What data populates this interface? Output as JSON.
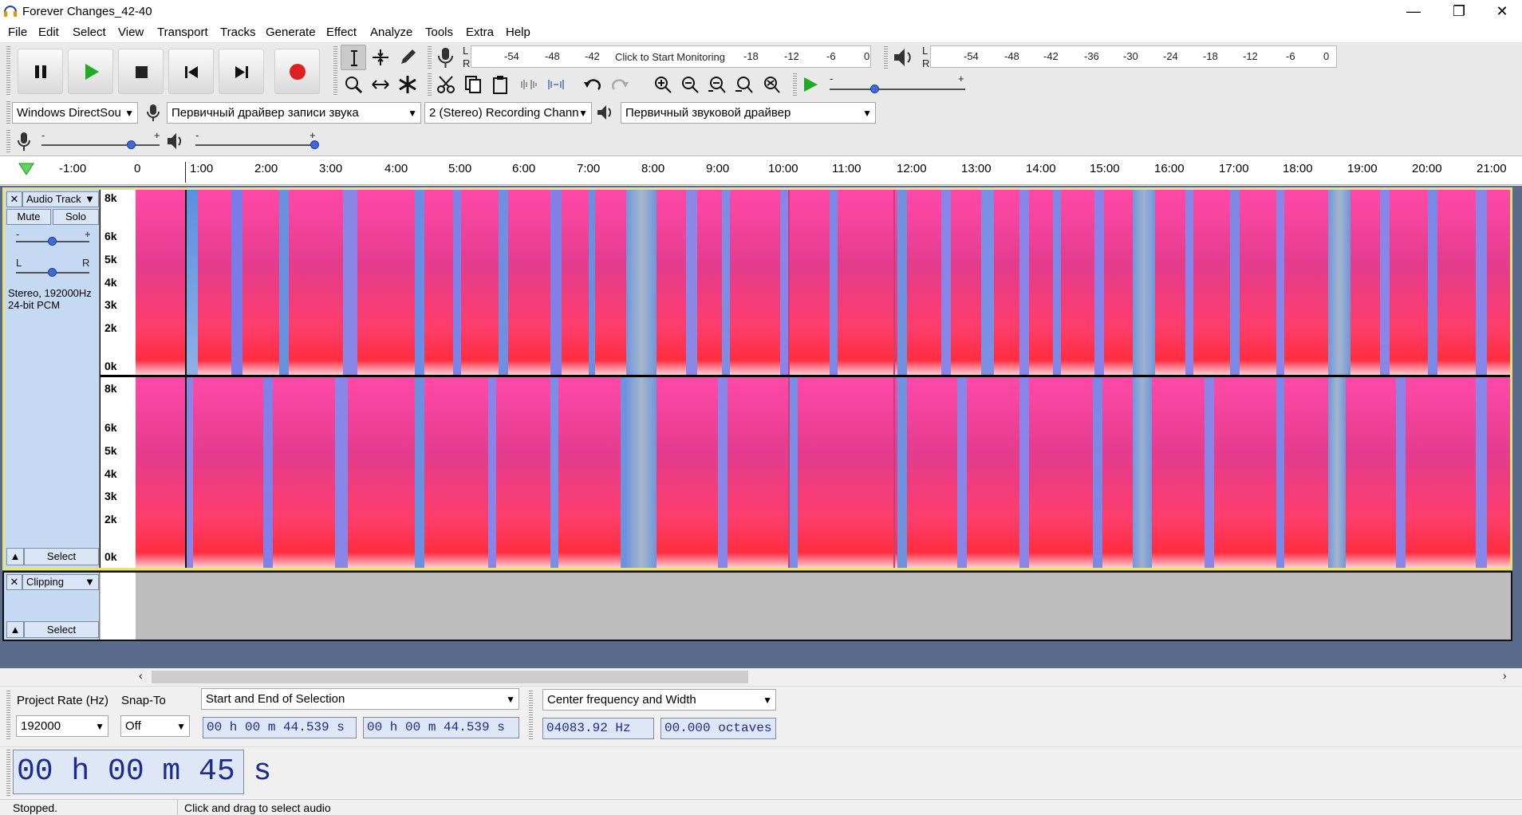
{
  "window": {
    "title": "Forever Changes_42-40",
    "min_glyph": "—",
    "max_glyph": "❐",
    "close_glyph": "✕"
  },
  "menu": [
    "File",
    "Edit",
    "Select",
    "View",
    "Transport",
    "Tracks",
    "Generate",
    "Effect",
    "Analyze",
    "Tools",
    "Extra",
    "Help"
  ],
  "transport": {
    "pause": "pause-icon",
    "play": "play-icon",
    "stop": "stop-icon",
    "skip_start": "skip-start-icon",
    "skip_end": "skip-end-icon",
    "record": "record-icon",
    "record_color": "#e02020",
    "play_color": "#22aa22"
  },
  "recording_meter": {
    "channels": [
      "L",
      "R"
    ],
    "ticks": [
      "-54",
      "-48",
      "-42",
      "-18",
      "-12",
      "-6",
      "0"
    ],
    "prompt": "Click to Start Monitoring"
  },
  "playback_meter": {
    "channels": [
      "L",
      "R"
    ],
    "ticks": [
      "-54",
      "-48",
      "-42",
      "-36",
      "-30",
      "-24",
      "-18",
      "-12",
      "-6",
      "0"
    ]
  },
  "playback_speed": {
    "minus": "-",
    "plus": "+"
  },
  "device": {
    "host": "Windows DirectSou",
    "recording_device": "Первичный драйвер записи звука",
    "channels": "2 (Stereo) Recording Chann",
    "playback_device": "Первичный звуковой драйвер"
  },
  "mixer": {
    "minus": "-",
    "plus": "+"
  },
  "ruler": {
    "labels": [
      "-1:00",
      "0",
      "1:00",
      "2:00",
      "3:00",
      "4:00",
      "5:00",
      "6:00",
      "7:00",
      "8:00",
      "9:00",
      "10:00",
      "11:00",
      "12:00",
      "13:00",
      "14:00",
      "15:00",
      "16:00",
      "17:00",
      "18:00",
      "19:00",
      "20:00",
      "21:00"
    ]
  },
  "audio_track": {
    "name": "Audio Track",
    "mute": "Mute",
    "solo": "Solo",
    "gain_minus": "-",
    "gain_plus": "+",
    "pan_left": "L",
    "pan_right": "R",
    "info_line1": "Stereo, 192000Hz",
    "info_line2": "24-bit PCM",
    "select": "Select",
    "freq_labels": [
      "8k",
      "6k",
      "5k",
      "4k",
      "3k",
      "2k",
      "0k"
    ]
  },
  "label_track": {
    "name": "Clipping",
    "select": "Select"
  },
  "selection_toolbar": {
    "project_rate_label": "Project Rate (Hz)",
    "project_rate": "192000",
    "snap_label": "Snap-To",
    "snap_value": "Off",
    "selection_mode": "Start and End of Selection",
    "start": "00 h 00 m 44.539 s",
    "end": "00 h 00 m 44.539 s"
  },
  "spectral_toolbar": {
    "mode": "Center frequency and Width",
    "frequency": "04083.92 Hz",
    "width": "00.000 octaves"
  },
  "time_toolbar": {
    "time": "00 h 00 m 45 s"
  },
  "status": {
    "state": "Stopped.",
    "hint": "Click and drag to select audio"
  }
}
